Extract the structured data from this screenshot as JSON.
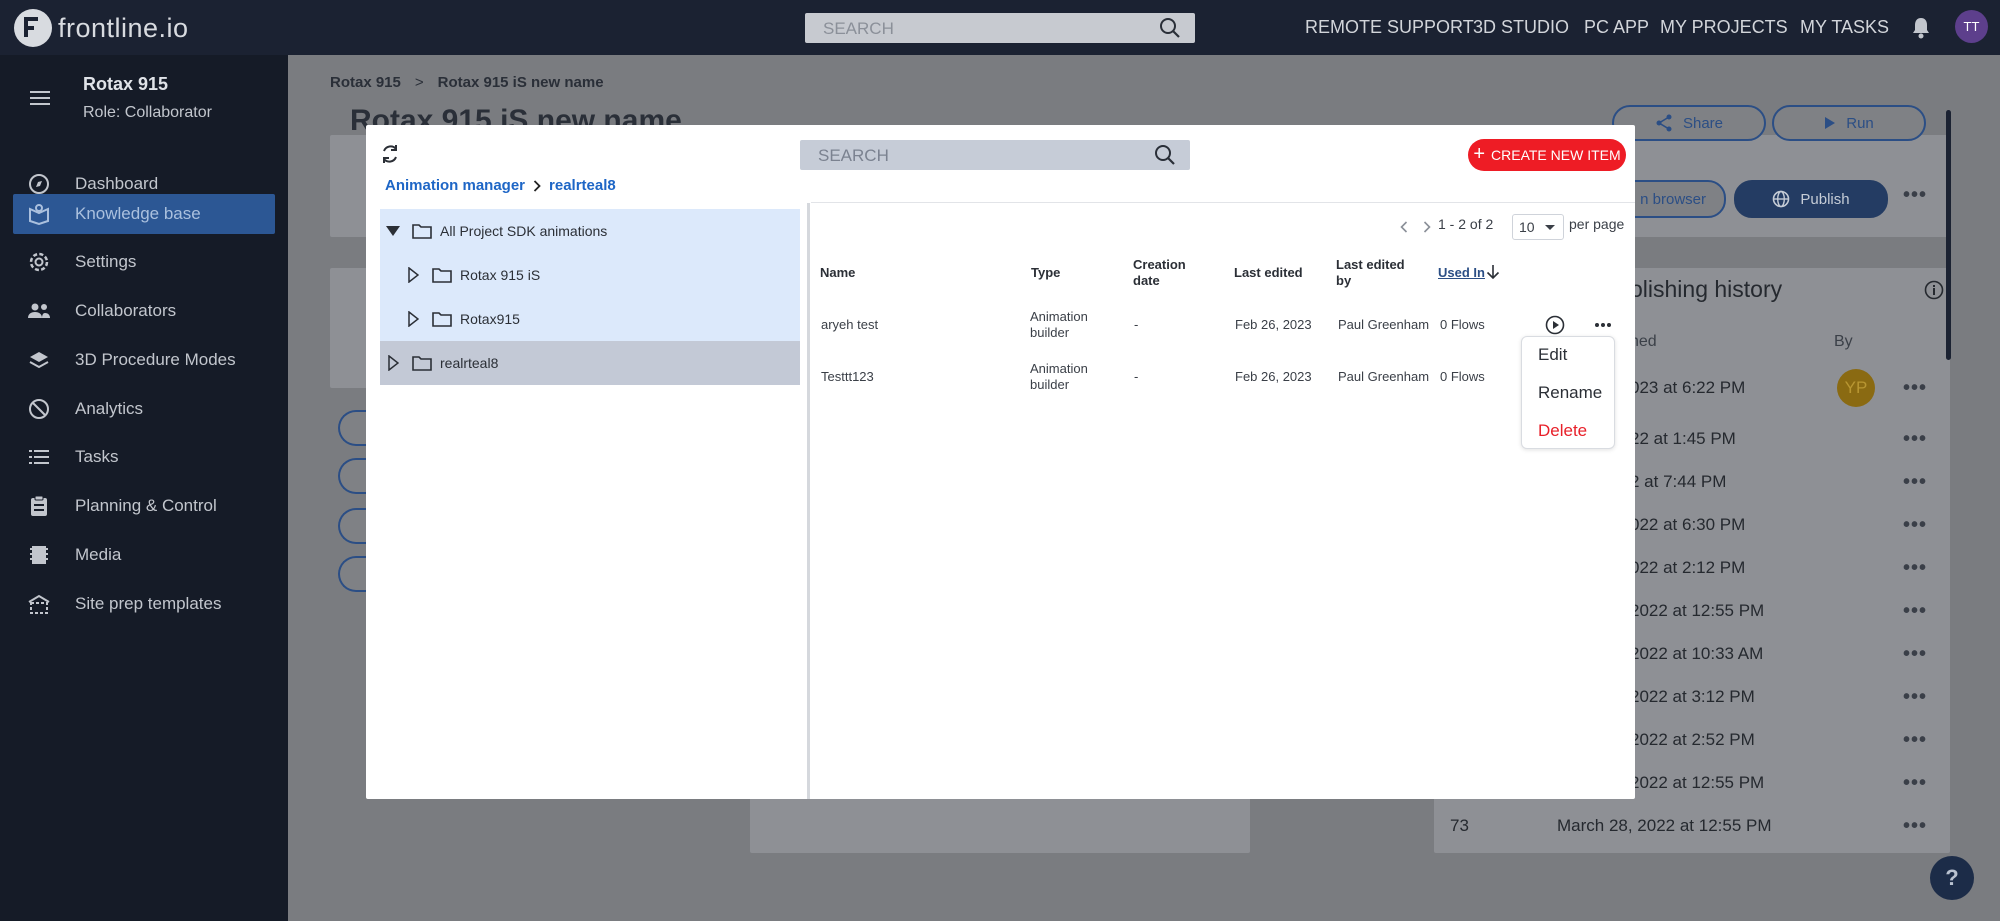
{
  "topbar": {
    "logo_text": "frontline.io",
    "search_placeholder": "SEARCH",
    "nav": [
      "REMOTE SUPPORT",
      "3D STUDIO",
      "PC APP",
      "MY PROJECTS",
      "MY TASKS"
    ],
    "avatar_initials": "TT"
  },
  "sidebar": {
    "project_title": "Rotax 915",
    "role": "Role: Collaborator",
    "items": [
      {
        "label": "Dashboard",
        "icon": "compass-icon"
      },
      {
        "label": "Knowledge base",
        "icon": "book-icon",
        "active": true
      },
      {
        "label": "Settings",
        "icon": "gear-icon"
      },
      {
        "label": "Collaborators",
        "icon": "people-icon"
      },
      {
        "label": "3D Procedure Modes",
        "icon": "layers-icon"
      },
      {
        "label": "Analytics",
        "icon": "analytics-icon"
      },
      {
        "label": "Tasks",
        "icon": "list-icon"
      },
      {
        "label": "Planning & Control",
        "icon": "clipboard-icon"
      },
      {
        "label": "Media",
        "icon": "film-icon"
      },
      {
        "label": "Site prep templates",
        "icon": "site-icon"
      }
    ]
  },
  "background": {
    "breadcrumb": [
      "Rotax 915",
      "Rotax 915 iS new name"
    ],
    "title": "Rotax 915 iS new name",
    "share_label": "Share",
    "run_label": "Run",
    "browser_label": "n browser",
    "publish_label": "Publish",
    "history_title": "olishing history",
    "history_col_published": "hed",
    "history_col_by": "By",
    "history_rows": [
      "023 at 6:22 PM",
      "22 at 1:45 PM",
      "2 at 7:44 PM",
      "022 at 6:30 PM",
      "022 at 2:12 PM",
      "2022 at 12:55 PM",
      "2022 at 10:33 AM",
      "2022 at 3:12 PM",
      "2022 at 2:52 PM",
      "2022 at 12:55 PM",
      "March 28, 2022 at 12:55 PM"
    ],
    "history_last_num": "73",
    "avatar_yp": "YP",
    "help_label": "?"
  },
  "modal": {
    "search_placeholder": "SEARCH",
    "create_label": "CREATE NEW ITEM",
    "breadcrumb": [
      "Animation manager",
      "realrteal8"
    ],
    "tree": [
      {
        "label": "All Project SDK animations",
        "expanded": true
      },
      {
        "label": "Rotax 915 iS"
      },
      {
        "label": "Rotax915"
      },
      {
        "label": "realrteal8"
      }
    ],
    "pager_text": "1 - 2 of 2",
    "per_page_value": "10",
    "per_page_label": "per page",
    "columns": [
      "Name",
      "Type",
      "Creation date",
      "Last edited",
      "Last edited by",
      "Used In"
    ],
    "rows": [
      {
        "name": "aryeh test",
        "type": "Animation builder",
        "created": "-",
        "edited": "Feb 26, 2023",
        "by": "Paul Greenham",
        "used": "0 Flows"
      },
      {
        "name": "Testtt123",
        "type": "Animation builder",
        "created": "-",
        "edited": "Feb 26, 2023",
        "by": "Paul Greenham",
        "used": "0 Flows"
      }
    ],
    "context_menu": [
      "Edit",
      "Rename",
      "Delete"
    ]
  }
}
